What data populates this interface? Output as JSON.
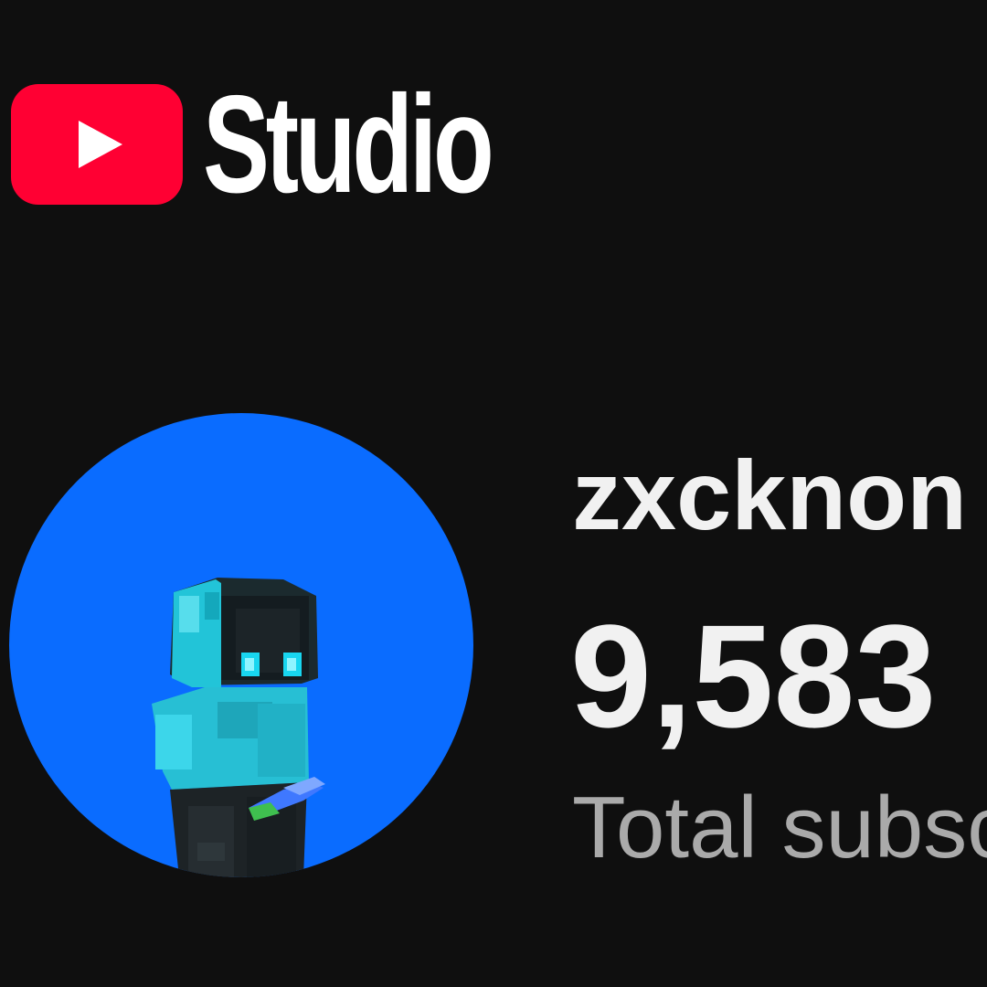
{
  "header": {
    "logo_text": "Studio",
    "logo_icon": "youtube-play-icon",
    "brand_color": "#ff0033"
  },
  "channel": {
    "name": "zxcknon",
    "subscriber_count": "9,583",
    "subscriber_label": "Total subsc",
    "avatar_background": "#0a6cff"
  }
}
